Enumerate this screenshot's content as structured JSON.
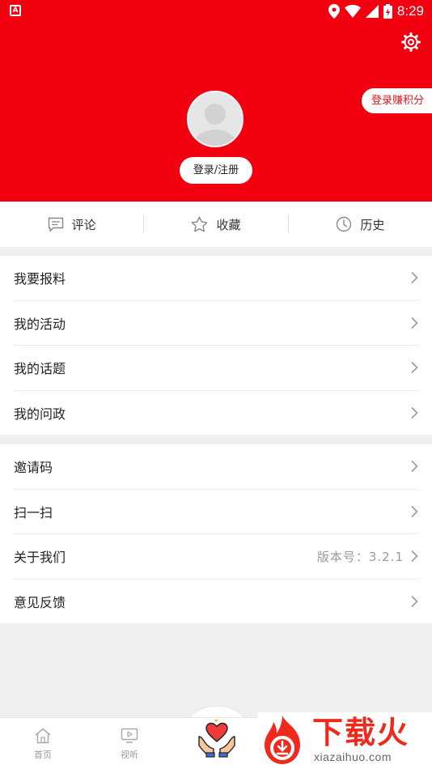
{
  "status_bar": {
    "time": "8:29",
    "left_icon_glyph": "A",
    "icons": [
      "location-icon",
      "wifi-icon",
      "signal-icon",
      "battery-icon"
    ]
  },
  "header": {
    "background": "#f2000f",
    "earn_points_label": "登录赚积分",
    "login_label": "登录/注册"
  },
  "quick_actions": [
    {
      "label": "评论",
      "icon": "comment-icon"
    },
    {
      "label": "收藏",
      "icon": "star-icon"
    },
    {
      "label": "历史",
      "icon": "clock-icon"
    }
  ],
  "group1": [
    {
      "label": "我要报料"
    },
    {
      "label": "我的活动"
    },
    {
      "label": "我的话题"
    },
    {
      "label": "我的问政"
    }
  ],
  "group2": [
    {
      "label": "邀请码",
      "extra": ""
    },
    {
      "label": "扫一扫",
      "extra": ""
    },
    {
      "label": "关于我们",
      "extra": "版本号：3.2.1"
    },
    {
      "label": "意见反馈",
      "extra": ""
    }
  ],
  "bottom_nav": [
    {
      "label": "首页",
      "icon": "home-icon"
    },
    {
      "label": "视听",
      "icon": "video-icon"
    },
    {
      "label": "",
      "icon": "heart-hands-icon"
    }
  ],
  "watermark": {
    "title": "下载火",
    "url": "xiazaihuo.com"
  },
  "colors": {
    "accent": "#f2000f",
    "text": "#222222",
    "muted": "#999999"
  }
}
